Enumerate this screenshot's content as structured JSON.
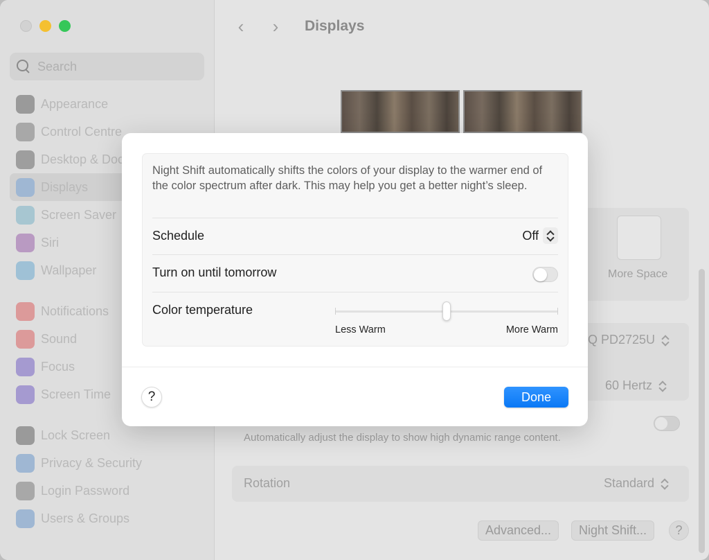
{
  "sidebar": {
    "search_placeholder": "Search",
    "items": [
      {
        "label": "Appearance",
        "icon": "appearance-icon",
        "color": "#9a9a9a"
      },
      {
        "label": "Control Centre",
        "icon": "control-centre-icon",
        "color": "#a8a8a8"
      },
      {
        "label": "Desktop & Dock",
        "icon": "desktop-dock-icon",
        "color": "#9e9e9e"
      },
      {
        "label": "Displays",
        "icon": "displays-icon",
        "color": "#9fb7d3"
      },
      {
        "label": "Screen Saver",
        "icon": "screen-saver-icon",
        "color": "#a7c6d1"
      },
      {
        "label": "Siri",
        "icon": "siri-icon",
        "color": "#b99ac2"
      },
      {
        "label": "Wallpaper",
        "icon": "wallpaper-icon",
        "color": "#9fc1d6"
      },
      {
        "label": "Notifications",
        "icon": "notifications-icon",
        "color": "#dc9a9a"
      },
      {
        "label": "Sound",
        "icon": "sound-icon",
        "color": "#dc9a9a"
      },
      {
        "label": "Focus",
        "icon": "focus-icon",
        "color": "#a59ad0"
      },
      {
        "label": "Screen Time",
        "icon": "screen-time-icon",
        "color": "#a59ad0"
      },
      {
        "label": "Lock Screen",
        "icon": "lock-screen-icon",
        "color": "#9a9a9a"
      },
      {
        "label": "Privacy & Security",
        "icon": "privacy-security-icon",
        "color": "#9fb7d3"
      },
      {
        "label": "Login Password",
        "icon": "login-password-icon",
        "color": "#a8a8a8"
      },
      {
        "label": "Users & Groups",
        "icon": "users-groups-icon",
        "color": "#9fb7d3"
      }
    ]
  },
  "header": {
    "title": "Displays",
    "back_icon": "chevron-left-icon",
    "forward_icon": "chevron-right-icon"
  },
  "background": {
    "more_space_label": "More Space",
    "display_value": "Q PD2725U",
    "refresh_value": "60 Hertz",
    "hdr_desc": "Automatically adjust the display to show high dynamic range content.",
    "rotation_label": "Rotation",
    "rotation_value": "Standard",
    "advanced_button": "Advanced...",
    "night_shift_button": "Night Shift...",
    "help_label": "?"
  },
  "modal": {
    "description": "Night Shift automatically shifts the colors of your display to the warmer end of the color spectrum after dark. This may help you get a better night’s sleep.",
    "schedule_label": "Schedule",
    "schedule_value": "Off",
    "turn_on_label": "Turn on until tomorrow",
    "turn_on_state": false,
    "color_temp_label": "Color temperature",
    "color_temp_value": 0.5,
    "less_warm_label": "Less Warm",
    "more_warm_label": "More Warm",
    "help_label": "?",
    "done_label": "Done",
    "accent_color": "#0a78f5"
  }
}
